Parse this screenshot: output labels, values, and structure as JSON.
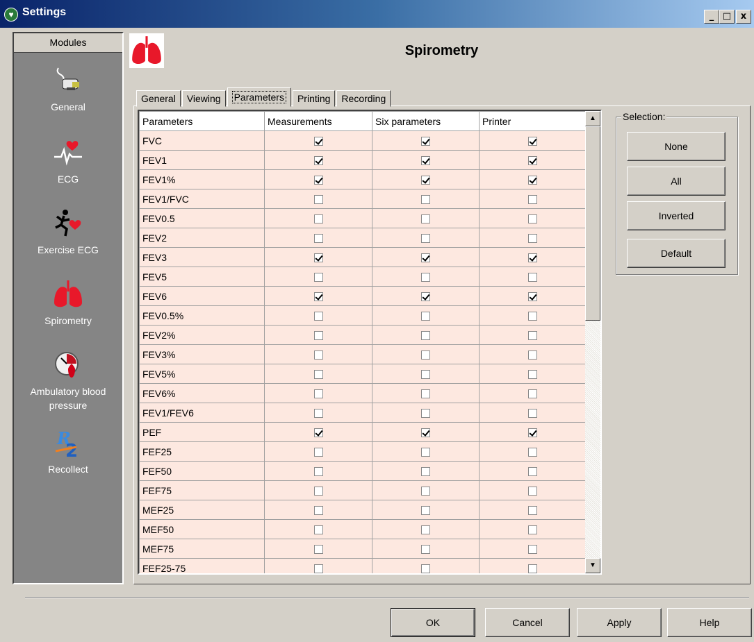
{
  "window": {
    "title": "Settings",
    "controls": [
      "_",
      "□",
      "x"
    ]
  },
  "sidebar": {
    "header": "Modules",
    "items": [
      {
        "label": "General",
        "icon": "plug-icon"
      },
      {
        "label": "ECG",
        "icon": "ecg-heart-icon"
      },
      {
        "label": "Exercise ECG",
        "icon": "runner-heart-icon"
      },
      {
        "label": "Spirometry",
        "icon": "lungs-icon"
      },
      {
        "label": "Ambulatory blood pressure",
        "icon": "blood-pressure-icon"
      },
      {
        "label": "Recollect",
        "icon": "recollect-r2-icon"
      }
    ]
  },
  "header": {
    "title": "Spirometry",
    "icon": "lungs-icon"
  },
  "tabs": [
    "General",
    "Viewing",
    "Parameters",
    "Printing",
    "Recording"
  ],
  "active_tab": "Parameters",
  "grid": {
    "columns": [
      "Parameters",
      "Measurements",
      "Six parameters",
      "Printer"
    ],
    "rows": [
      {
        "name": "FVC",
        "measurements": true,
        "six": true,
        "printer": true
      },
      {
        "name": "FEV1",
        "measurements": true,
        "six": true,
        "printer": true
      },
      {
        "name": "FEV1%",
        "measurements": true,
        "six": true,
        "printer": true
      },
      {
        "name": "FEV1/FVC",
        "measurements": false,
        "six": false,
        "printer": false
      },
      {
        "name": "FEV0.5",
        "measurements": false,
        "six": false,
        "printer": false
      },
      {
        "name": "FEV2",
        "measurements": false,
        "six": false,
        "printer": false
      },
      {
        "name": "FEV3",
        "measurements": true,
        "six": true,
        "printer": true
      },
      {
        "name": "FEV5",
        "measurements": false,
        "six": false,
        "printer": false
      },
      {
        "name": "FEV6",
        "measurements": true,
        "six": true,
        "printer": true
      },
      {
        "name": "FEV0.5%",
        "measurements": false,
        "six": false,
        "printer": false
      },
      {
        "name": "FEV2%",
        "measurements": false,
        "six": false,
        "printer": false
      },
      {
        "name": "FEV3%",
        "measurements": false,
        "six": false,
        "printer": false
      },
      {
        "name": "FEV5%",
        "measurements": false,
        "six": false,
        "printer": false
      },
      {
        "name": "FEV6%",
        "measurements": false,
        "six": false,
        "printer": false
      },
      {
        "name": "FEV1/FEV6",
        "measurements": false,
        "six": false,
        "printer": false
      },
      {
        "name": "PEF",
        "measurements": true,
        "six": true,
        "printer": true
      },
      {
        "name": "FEF25",
        "measurements": false,
        "six": false,
        "printer": false
      },
      {
        "name": "FEF50",
        "measurements": false,
        "six": false,
        "printer": false
      },
      {
        "name": "FEF75",
        "measurements": false,
        "six": false,
        "printer": false
      },
      {
        "name": "MEF25",
        "measurements": false,
        "six": false,
        "printer": false
      },
      {
        "name": "MEF50",
        "measurements": false,
        "six": false,
        "printer": false
      },
      {
        "name": "MEF75",
        "measurements": false,
        "six": false,
        "printer": false
      },
      {
        "name": "FEF25-75",
        "measurements": false,
        "six": false,
        "printer": false
      }
    ]
  },
  "selection": {
    "label": "Selection:",
    "buttons": [
      "None",
      "All",
      "Inverted",
      "Default"
    ]
  },
  "footer": {
    "ok": "OK",
    "cancel": "Cancel",
    "apply": "Apply",
    "help": "Help"
  },
  "colors": {
    "row_bg": "#fde8e0",
    "sidebar_bg": "#858585",
    "title_bar": "#0a246a"
  }
}
